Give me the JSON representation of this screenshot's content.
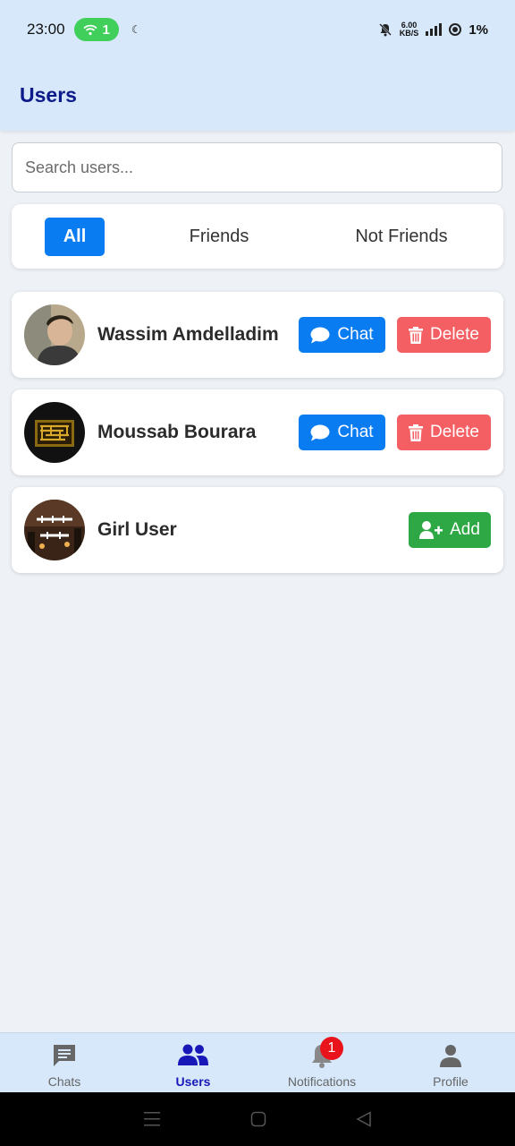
{
  "status_bar": {
    "time": "23:00",
    "hotspot_count": "1",
    "speed_value": "6.00",
    "speed_unit": "KB/S",
    "battery": "1%"
  },
  "header": {
    "title": "Users"
  },
  "search": {
    "placeholder": "Search users...",
    "value": ""
  },
  "filters": {
    "tabs": [
      {
        "label": "All",
        "active": true
      },
      {
        "label": "Friends",
        "active": false
      },
      {
        "label": "Not Friends",
        "active": false
      }
    ]
  },
  "users": [
    {
      "name": "Wassim Amdelladim",
      "actions": [
        "Chat",
        "Delete"
      ]
    },
    {
      "name": "Moussab Bourara",
      "actions": [
        "Chat",
        "Delete"
      ]
    },
    {
      "name": "Girl User",
      "actions": [
        "Add"
      ]
    }
  ],
  "actions": {
    "chat_label": "Chat",
    "delete_label": "Delete",
    "add_label": "Add"
  },
  "bottom_nav": {
    "items": [
      {
        "label": "Chats",
        "icon": "chat-icon",
        "active": false
      },
      {
        "label": "Users",
        "icon": "users-icon",
        "active": true
      },
      {
        "label": "Notifications",
        "icon": "bell-icon",
        "active": false,
        "badge": "1"
      },
      {
        "label": "Profile",
        "icon": "person-icon",
        "active": false
      }
    ]
  },
  "colors": {
    "primary": "#0a7cf2",
    "danger": "#f45f63",
    "success": "#2ea844",
    "header_bg": "#d6e8fa",
    "title": "#0d1a8a",
    "nav_active": "#1818b8"
  }
}
